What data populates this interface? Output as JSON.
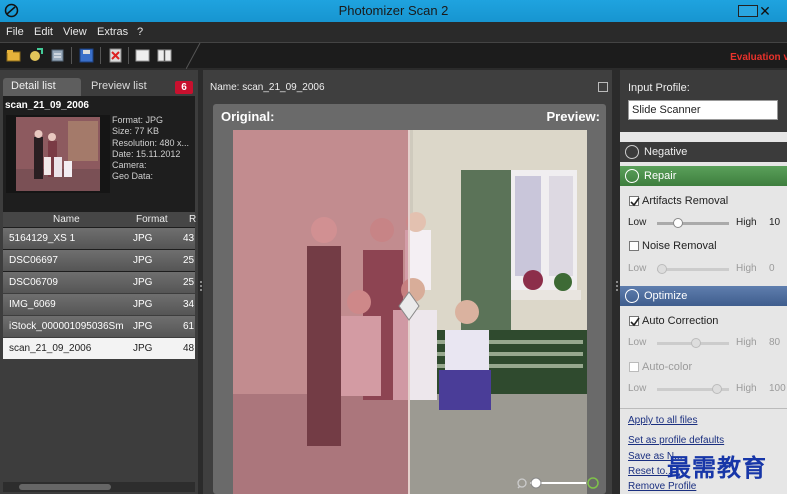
{
  "window": {
    "title": "Photomizer Scan 2",
    "close_glyph": "✕"
  },
  "menu": [
    "File",
    "Edit",
    "View",
    "Extras",
    "?"
  ],
  "toolbar": {
    "eval_label": "Evaluation v"
  },
  "left": {
    "tabs": [
      "Detail list",
      "Preview list"
    ],
    "badge": "6",
    "selected_name": "scan_21_09_2006",
    "meta": [
      "Format: JPG",
      "Size: 77 KB",
      "Resolution: 480 x...",
      "Date: 15.11.2012",
      "Camera:",
      "Geo Data:"
    ],
    "columns": [
      "Name",
      "Format",
      "R"
    ],
    "rows": [
      {
        "name": "5164129_XS 1",
        "format": "JPG",
        "res": "43"
      },
      {
        "name": "DSC06697",
        "format": "JPG",
        "res": "25"
      },
      {
        "name": "DSC06709",
        "format": "JPG",
        "res": "25"
      },
      {
        "name": "IMG_6069",
        "format": "JPG",
        "res": "34"
      },
      {
        "name": "iStock_000001095036Sm",
        "format": "JPG",
        "res": "61"
      },
      {
        "name": "scan_21_09_2006",
        "format": "JPG",
        "res": "48"
      }
    ]
  },
  "center": {
    "name_label": "Name: scan_21_09_2006",
    "original_label": "Original:",
    "preview_label": "Preview:"
  },
  "right": {
    "input_profile_label": "Input Profile:",
    "profile_value": "Slide Scanner",
    "negative": "Negative",
    "repair": "Repair",
    "artifacts_removal": "Artifacts Removal",
    "noise_removal": "Noise Removal",
    "optimize": "Optimize",
    "auto_correction": "Auto Correction",
    "auto_color": "Auto-color",
    "low": "Low",
    "high": "High",
    "sliders": [
      {
        "value": "10",
        "level": 0.25
      },
      {
        "value": "0",
        "level": 0.0
      },
      {
        "value": "80",
        "level": 0.55
      },
      {
        "value": "100",
        "level": 0.88
      }
    ],
    "links": [
      "Apply to all files",
      "Set as profile defaults",
      "Save as N...",
      "Reset to...",
      "Remove Profile"
    ]
  },
  "watermark": "最需教育"
}
